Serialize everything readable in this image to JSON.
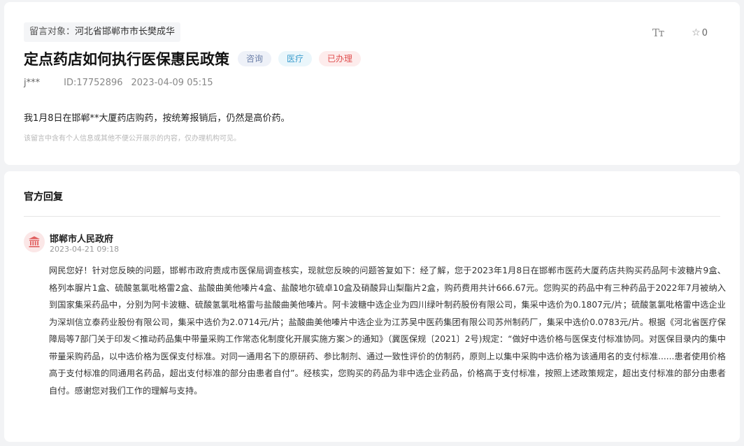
{
  "message": {
    "target_label": "留言对象：",
    "target_value": "河北省邯郸市市长樊成华",
    "font_size_icon": "Tт",
    "favorite_count": "0",
    "title": "定点药店如何执行医保惠民政策",
    "badges": [
      "咨询",
      "医疗",
      "已办理"
    ],
    "author": "j***",
    "id_text": "ID:17752896",
    "datetime": "2023-04-09 05:15",
    "content": "我1月8日在邯郸**大厦药店购药，按统筹报销后，仍然是高价药。",
    "privacy_note": "该留言中含有个人信息或其他不便公开展示的内容，仅办理机构可见。"
  },
  "reply": {
    "section_title": "官方回复",
    "org_name": "邯郸市人民政府",
    "datetime": "2023-04-21 09:18",
    "body": "网民您好！针对您反映的问题，邯郸市政府责成市医保局调查核实，现就您反映的问题答复如下：经了解，您于2023年1月8日在邯郸市医药大厦药店共购买药品阿卡波糖片9盒、格列本脲片1盒、硫酸氢氯吡格雷2盒、盐酸曲美他嗪片4盒、盐酸地尔硫卓10盒及硝酸异山梨酯片2盒，购药费用共计666.67元。您购买的药品中有三种药品于2022年7月被纳入到国家集采药品中，分别为阿卡波糖、硫酸氢氯吡格雷与盐酸曲美他嗪片。阿卡波糖中选企业为四川绿叶制药股份有限公司，集采中选价为0.1807元/片；硫酸氢氯吡格雷中选企业为深圳信立泰药业股份有限公司，集采中选价为2.0714元/片；盐酸曲美他嗪片中选企业为江苏吴中医药集团有限公司苏州制药厂，集采中选价0.0783元/片。根据《河北省医疗保障局等7部门关于印发＜推动药品集中带量采购工作常态化制度化开展实施方案＞的通知》（冀医保规〔2021〕2号)规定：“做好中选价格与医保支付标准协同。对医保目录内的集中带量采购药品，以中选价格为医保支付标准。对同一通用名下的原研药、参比制剂、通过一致性评价的仿制药，原则上以集中采购中选价格为该通用名的支付标准......患者使用价格高于支付标准的同通用名药品，超出支付标准的部分由患者自付”。经核实，您购买的药品为非中选企业药品，价格高于支付标准，按照上述政策规定，超出支付标准的部分由患者自付。感谢您对我们工作的理解与支持。"
  },
  "colors": {
    "badge_consult": "#6b7fa8",
    "badge_medical": "#3f9fce",
    "badge_done": "#e05050",
    "gov_icon": "#e06060"
  }
}
